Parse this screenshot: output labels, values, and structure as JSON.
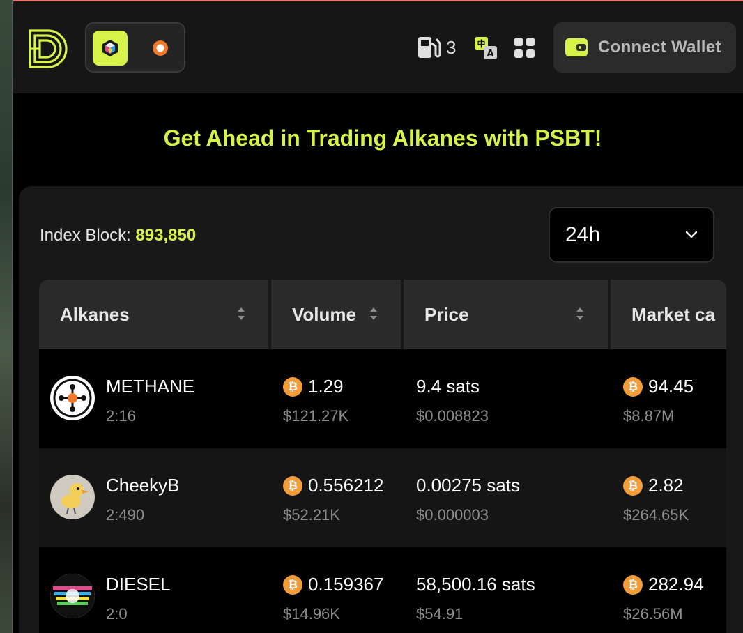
{
  "header": {
    "gas_count": "3",
    "connect_wallet_label": "Connect Wallet"
  },
  "hero": {
    "title": "Get Ahead in Trading Alkanes with PSBT!"
  },
  "index": {
    "label": "Index Block:",
    "value": "893,850"
  },
  "timeframe": {
    "selected": "24h"
  },
  "table": {
    "columns": [
      "Alkanes",
      "Volume",
      "Price",
      "Market ca"
    ],
    "rows": [
      {
        "name": "METHANE",
        "id": "2:16",
        "volume_btc": "1.29",
        "volume_usd": "$121.27K",
        "price_sats": "9.4 sats",
        "price_usd": "$0.008823",
        "mcap_btc": "94.45",
        "mcap_usd": "$8.87M"
      },
      {
        "name": "CheekyB",
        "id": "2:490",
        "volume_btc": "0.556212",
        "volume_usd": "$52.21K",
        "price_sats": "0.00275 sats",
        "price_usd": "$0.000003",
        "mcap_btc": "2.82",
        "mcap_usd": "$264.65K"
      },
      {
        "name": "DIESEL",
        "id": "2:0",
        "volume_btc": "0.159367",
        "volume_usd": "$14.96K",
        "price_sats": "58,500.16 sats",
        "price_usd": "$54.91",
        "mcap_btc": "282.94",
        "mcap_usd": "$26.56M"
      }
    ]
  },
  "colors": {
    "accent": "#d7f34a",
    "btc": "#f39c3a",
    "header_bg": "#161616",
    "panel_bg": "#181818"
  }
}
